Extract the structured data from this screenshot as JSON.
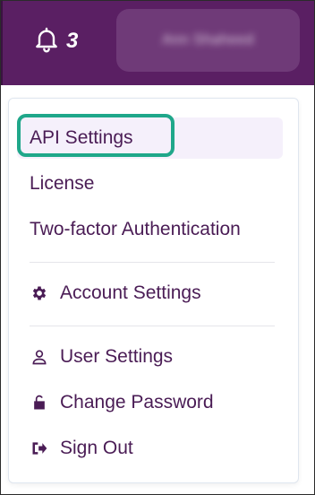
{
  "header": {
    "notification_count": "3",
    "user_name": "Ann Shaheed"
  },
  "menu": {
    "items": [
      {
        "label": "API Settings"
      },
      {
        "label": "License"
      },
      {
        "label": "Two-factor Authentication"
      },
      {
        "label": "Account Settings",
        "icon": "gear-icon"
      },
      {
        "label": "User Settings",
        "icon": "user-icon"
      },
      {
        "label": "Change Password",
        "icon": "unlock-icon"
      },
      {
        "label": "Sign Out",
        "icon": "sign-out-icon"
      }
    ]
  },
  "colors": {
    "topbar": "#5a1f63",
    "menu_text": "#4a1c55",
    "highlight_bg": "#f5f0fb",
    "callout_border": "#1fa78a"
  }
}
